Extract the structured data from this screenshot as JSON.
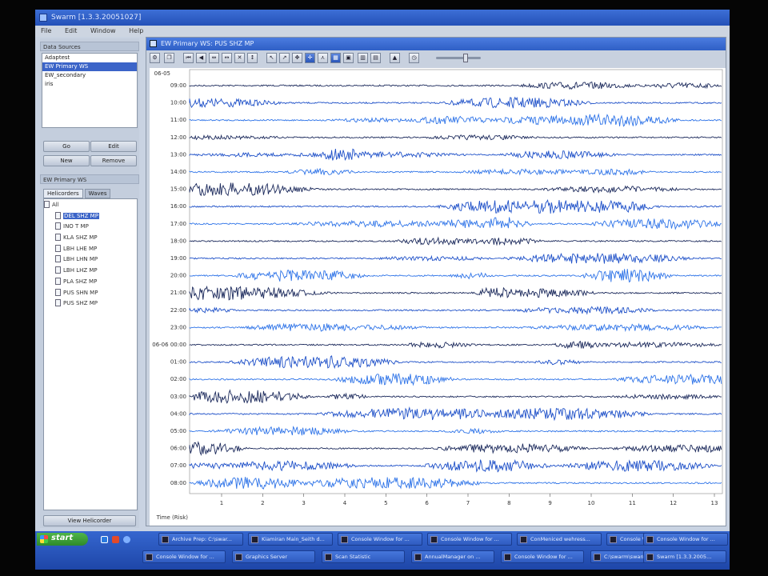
{
  "window": {
    "title": "Swarm [1.3.3.20051027]"
  },
  "menu": [
    "File",
    "Edit",
    "Window",
    "Help"
  ],
  "data_sources": {
    "label": "Data Sources",
    "items": [
      "Adaptest",
      "EW Primary WS",
      "EW_secondary",
      "iris"
    ],
    "selected_index": 1
  },
  "buttons": {
    "go": "Go",
    "edit": "Edit",
    "new": "New",
    "remove": "Remove",
    "view_helicorder": "View Helicorder"
  },
  "stations": {
    "label": "EW Primary WS",
    "tabs": [
      "Helicorders",
      "Waves"
    ],
    "active_tab": 0,
    "root": "All",
    "items": [
      "DEL SHZ MP",
      "INO T MP",
      "KLA SHZ MP",
      "LBH LHE MP",
      "LBH LHN MP",
      "LBH LHZ MP",
      "PLA SHZ MP",
      "PUS SHN MP",
      "PUS SHZ MP"
    ],
    "selected_index": 0
  },
  "helicorder": {
    "title": "EW Primary WS: PUS SHZ MP",
    "top_label": "06-05",
    "row_labels": [
      "09:00",
      "10:00",
      "11:00",
      "12:00",
      "13:00",
      "14:00",
      "15:00",
      "16:00",
      "17:00",
      "18:00",
      "19:00",
      "20:00",
      "21:00",
      "22:00",
      "23:00",
      "06-06 00:00",
      "01:00",
      "02:00",
      "03:00",
      "04:00",
      "05:00",
      "06:00",
      "07:00",
      "08:00"
    ],
    "x_ticks": [
      "1",
      "2",
      "3",
      "4",
      "5",
      "6",
      "7",
      "8",
      "9",
      "10",
      "11",
      "12",
      "13"
    ],
    "x_axis_label": "Time (Risk)",
    "colors": {
      "dark": "#1c2a5c",
      "mid": "#1e50c8",
      "light": "#2f74e8"
    }
  },
  "taskbar": {
    "start_label": "start",
    "tasks": [
      "Archive Prep: C:\\swar...",
      "Kiamiran Main_Seith d...",
      "Console Window for ...",
      "Console Window for ...",
      "ConMeniced wehress...",
      "Console Window for ...",
      "Console Window for ...",
      "Console Window for ...",
      "Graphics Server",
      "Scan Statistic",
      "AnnualManager on ...",
      "Console Window for ...",
      "C:\\swarm\\swarmit.b...",
      "Swarm [1.3.3.2005..."
    ]
  }
}
